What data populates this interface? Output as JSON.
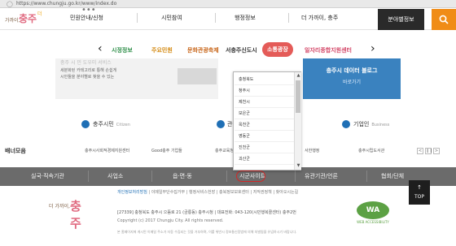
{
  "browser": {
    "url": "https://www.chungju.go.kr/www/index.do"
  },
  "brand": {
    "small": "가까이,",
    "big": "충주",
    "mark": "더",
    "footer_small": "더 가까이,",
    "footer_big": "충주"
  },
  "topnav": [
    "민원안내/신청",
    "시민참여",
    "행정정보",
    "더 가까이, 충주",
    "분야별정보"
  ],
  "subnav": [
    "시정정보",
    "주요민원",
    "문화관광축제",
    "서충주신도시",
    "소통광장",
    "일자리종합지원센터"
  ],
  "banner": {
    "left_title": "충주 시 민 도우미 서비스",
    "left_line1": "세분화된 카테고리로 통해 손쉽게",
    "left_line2": "시민들을 분야별로 찾을 수 있는",
    "right_title": "충주시 데이터 블로그",
    "right_link": "바로가기"
  },
  "quick": [
    {
      "label": "충주시민",
      "en": "Citizen"
    },
    {
      "label": "관광",
      "en": ""
    },
    {
      "label": "기업인",
      "en": "Business"
    }
  ],
  "banner_zone": {
    "title": "배너모음",
    "logos": [
      "충주시사회적경제지원센터",
      "Good충주 기업들",
      "충주교육청",
      "충주시 디지털",
      "서한행정",
      "충주시립도서관"
    ]
  },
  "footnav": [
    "실국·직속기관",
    "사업소",
    "읍·면·동",
    "시군사이트",
    "유관기관/언론",
    "협회/단체"
  ],
  "dropdown": [
    "충청북도",
    "청주시",
    "제천시",
    "보은군",
    "옥천군",
    "영동군",
    "진천군",
    "괴산군",
    "음성군"
  ],
  "footer": {
    "links": [
      "개인정보처리방침",
      "이메일무단수집거부",
      "행정서비스헌장",
      "충북정보보호센터",
      "저작권정책",
      "찾아오시는길"
    ],
    "address": "[27339] 충청북도 충주시 으뜸로 21 (금릉동) 충주시청 | 대표전화: 043-120(시민행복콜센터) 충주2번",
    "copyright": "Copyright (c) 2017 Chungju City. All rights reserved.",
    "note": "본 홈페이지에 게시된 이메일 주소가 자동 수집되는 것을 거부하며, 이를 위반시 정보통신망법에 의해 처벌됨을 유념하시기 바랍니다.",
    "wa_badge": "WA",
    "wa_caption": "WEB ACCESSIBILITY",
    "top_label": "TOP"
  },
  "colors": {
    "accent_orange": "#f08c16",
    "active_red": "#e45b58",
    "footnav_gray": "#6b6b6b",
    "brand_pink": "#e06a80"
  }
}
